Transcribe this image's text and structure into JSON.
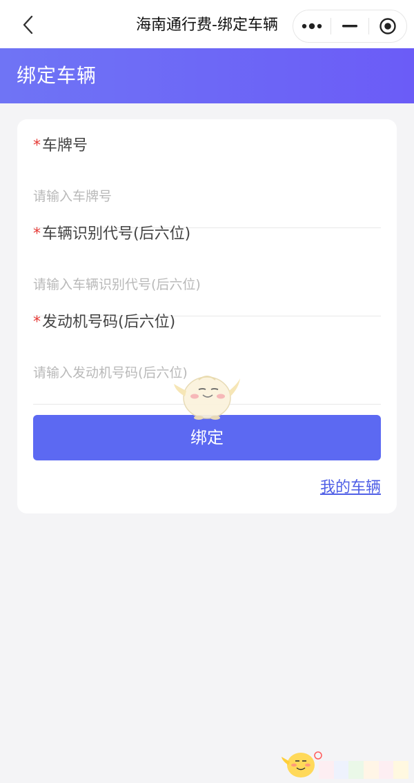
{
  "nav": {
    "title": "海南通行费-绑定车辆",
    "back_icon": "chevron-left-icon",
    "more_icon": "more-dots-icon",
    "minimize_icon": "minimize-icon",
    "close_icon": "target-close-icon"
  },
  "header": {
    "title": "绑定车辆",
    "gradient_start": "#6f74f5",
    "gradient_end": "#6b5cf7"
  },
  "form": {
    "required_mark": "*",
    "fields": [
      {
        "label": "车牌号",
        "placeholder": "请输入车牌号",
        "value": ""
      },
      {
        "label": "车辆识别代号(后六位)",
        "placeholder": "请输入车辆识别代号(后六位)",
        "value": ""
      },
      {
        "label": "发动机号码(后六位)",
        "placeholder": "请输入发动机号码(后六位)",
        "value": ""
      }
    ],
    "submit_label": "绑定",
    "my_vehicles_link": "我的车辆"
  },
  "colors": {
    "accent": "#5c69f2",
    "required": "#e53935",
    "link": "#4f5fe6",
    "background": "#f4f4f6"
  }
}
